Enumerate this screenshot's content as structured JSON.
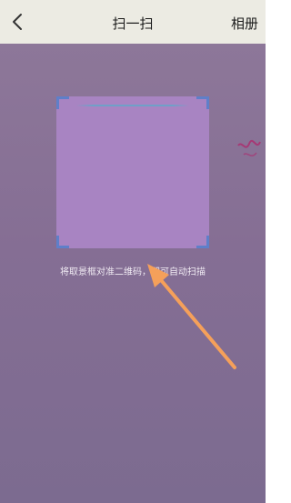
{
  "header": {
    "title": "扫一扫",
    "album_label": "相册",
    "back_icon": "chevron-left-icon"
  },
  "scanner": {
    "hint": "将取景框对准二维码，即可自动扫描"
  },
  "colors": {
    "header_bg": "#ecebe3",
    "camera_bg": "#8a7196",
    "frame_fill": "#a884c2",
    "frame_corner": "#5f7fc9",
    "annotation_arrow": "#f5a05a"
  }
}
